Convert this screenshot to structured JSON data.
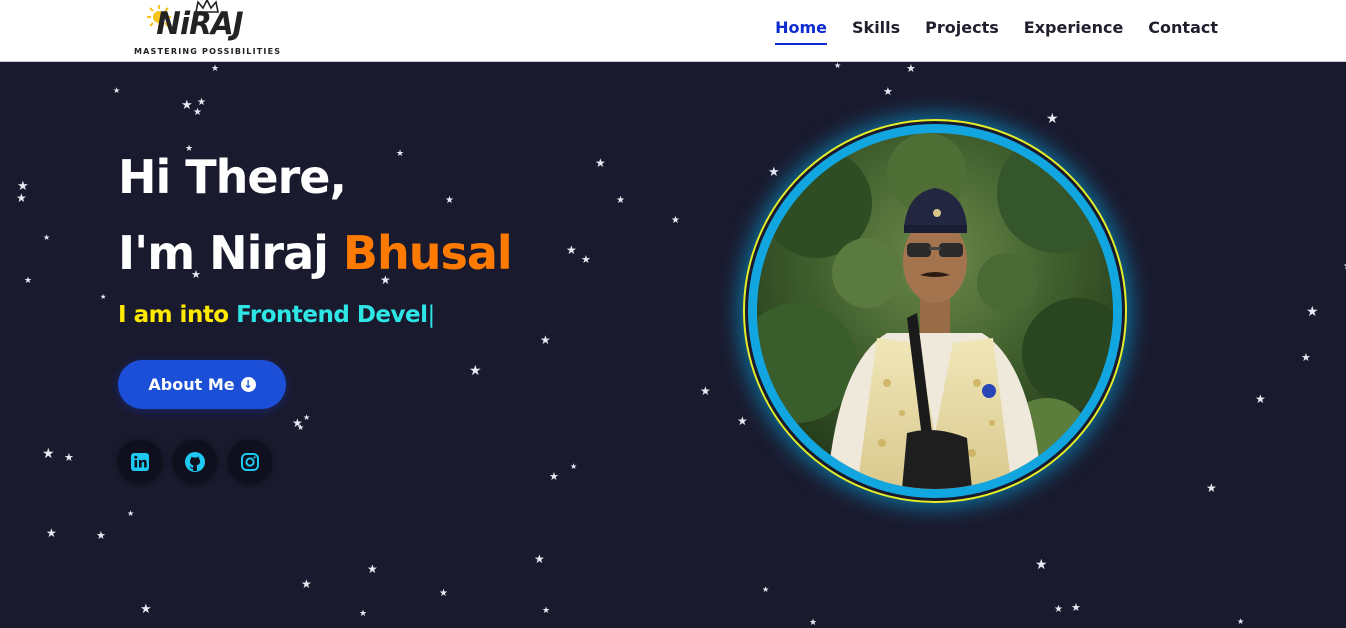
{
  "brand": {
    "logo_text": "NiRAJ",
    "tagline": "MASTERING POSSIBILITIES"
  },
  "nav": {
    "items": [
      {
        "label": "Home",
        "active": true
      },
      {
        "label": "Skills",
        "active": false
      },
      {
        "label": "Projects",
        "active": false
      },
      {
        "label": "Experience",
        "active": false
      },
      {
        "label": "Contact",
        "active": false
      }
    ]
  },
  "hero": {
    "greeting": "Hi There,",
    "intro": "I'm Niraj ",
    "name_accent": "Bhusal",
    "typing_lead": "I am into ",
    "typing_role": "Frontend Devel",
    "typing_cursor": "|",
    "about_button": "About Me"
  },
  "socials": [
    {
      "icon": "linkedin-icon"
    },
    {
      "icon": "github-icon"
    },
    {
      "icon": "instagram-icon"
    }
  ],
  "colors": {
    "background": "#1a1a2e",
    "accent_orange": "#ff7a00",
    "accent_yellow": "#ffea00",
    "accent_cyan": "#2ee6e6",
    "button_blue": "#1b4fd8",
    "nav_active": "#0d2bd0",
    "social_icon": "#1ec8f0",
    "ring_blue": "#11a6df",
    "ring_yellow": "#e3ef2a"
  }
}
